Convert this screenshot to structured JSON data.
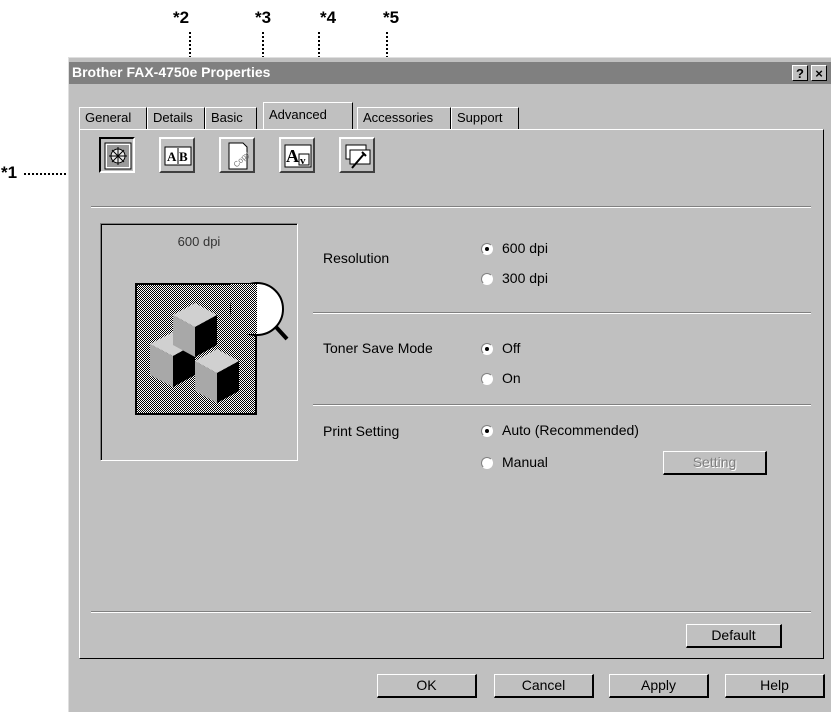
{
  "callouts": [
    "*1",
    "*2",
    "*3",
    "*4",
    "*5"
  ],
  "window": {
    "title": "Brother FAX-4750e Properties",
    "help_button": "?",
    "close_button": "×"
  },
  "tabs": [
    "General",
    "Details",
    "Basic",
    "Advanced",
    "Accessories",
    "Support"
  ],
  "active_tab": "Advanced",
  "toolbar_icons": [
    "print-quality-icon",
    "duplex-icon",
    "watermark-icon",
    "font-substitution-icon",
    "device-options-icon"
  ],
  "preview": {
    "label": "600 dpi"
  },
  "resolution": {
    "label": "Resolution",
    "options": [
      "600 dpi",
      "300 dpi"
    ],
    "selected": "600 dpi"
  },
  "toner_save": {
    "label": "Toner Save Mode",
    "options": [
      "Off",
      "On"
    ],
    "selected": "Off"
  },
  "print_setting": {
    "label": "Print Setting",
    "options": [
      "Auto (Recommended)",
      "Manual"
    ],
    "selected": "Auto (Recommended)",
    "setting_button": "Setting"
  },
  "default_button": "Default",
  "footer_buttons": {
    "ok": "OK",
    "cancel": "Cancel",
    "apply": "Apply",
    "help": "Help"
  }
}
